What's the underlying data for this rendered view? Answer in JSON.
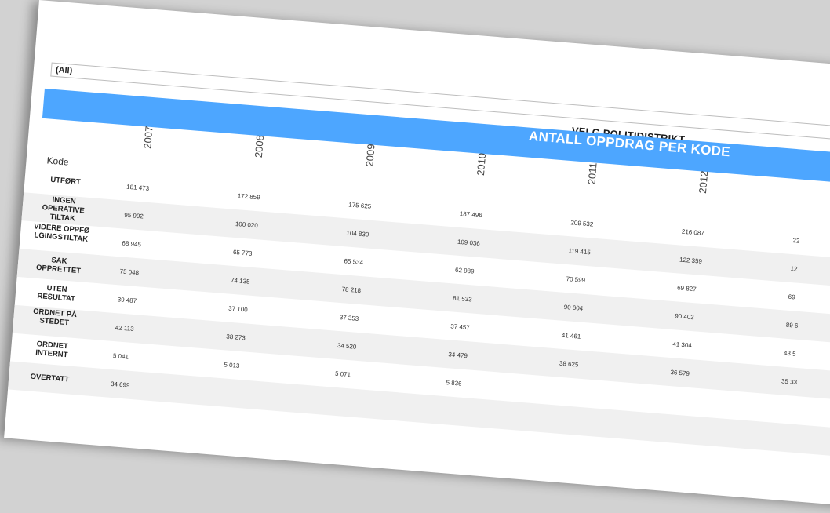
{
  "filter": {
    "value": "(All)",
    "label": "VELG POLITIDISTRIKT"
  },
  "table": {
    "title": "ANTALL OPPDRAG PER KODE",
    "code_header": "Kode",
    "years": [
      "2007",
      "2008",
      "2009",
      "2010",
      "2011",
      "2012"
    ],
    "rows": [
      {
        "label": "UTFØRT",
        "values": [
          "181 473",
          "172 859",
          "175 625",
          "187 496",
          "209 532",
          "216 087",
          "22"
        ]
      },
      {
        "label": "INGEN OPERATIVE TILTAK",
        "values": [
          "95 992",
          "100 020",
          "104 830",
          "109 036",
          "119 415",
          "122 359",
          "12"
        ]
      },
      {
        "label": "VIDERE OPPFØ LGINGSTILTAK",
        "values": [
          "68 945",
          "65 773",
          "65 534",
          "62 989",
          "70 599",
          "69 827",
          "69"
        ]
      },
      {
        "label": "SAK OPPRETTET",
        "values": [
          "75 048",
          "74 135",
          "78 218",
          "81 533",
          "90 604",
          "90 403",
          "89 6"
        ]
      },
      {
        "label": "UTEN RESULTAT",
        "values": [
          "39 487",
          "37 100",
          "37 353",
          "37 457",
          "41 461",
          "41 304",
          "43 5"
        ]
      },
      {
        "label": "ORDNET PÅ STEDET",
        "values": [
          "42 113",
          "38 273",
          "34 520",
          "34 479",
          "38 625",
          "36 579",
          "35 33"
        ]
      },
      {
        "label": "ORDNET INTERNT",
        "values": [
          "5 041",
          "5 013",
          "5 071",
          "5 836",
          "",
          "",
          ""
        ]
      },
      {
        "label": "OVERTATT",
        "values": [
          "34 699",
          "",
          "",
          "",
          "",
          "",
          ""
        ]
      }
    ]
  }
}
